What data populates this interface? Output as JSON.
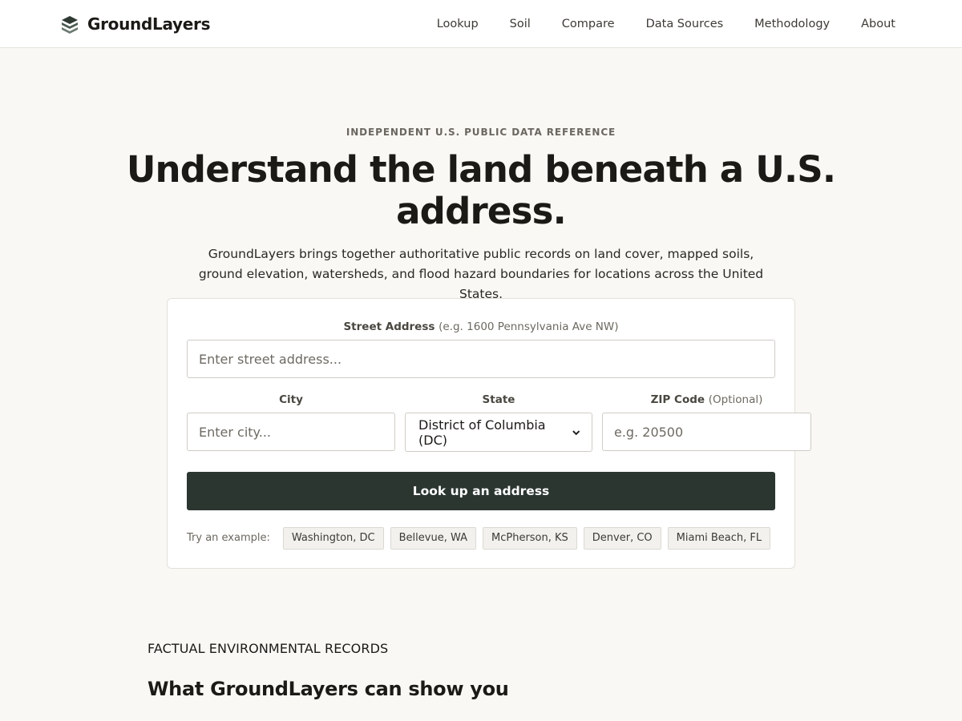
{
  "header": {
    "logo_text": "GroundLayers",
    "logo_icon": "layers-stack-icon",
    "nav": [
      {
        "label": "Lookup"
      },
      {
        "label": "Soil"
      },
      {
        "label": "Compare"
      },
      {
        "label": "Data Sources"
      },
      {
        "label": "Methodology"
      },
      {
        "label": "About"
      }
    ]
  },
  "hero": {
    "eyebrow": "INDEPENDENT U.S. PUBLIC DATA REFERENCE",
    "title": "Understand the land beneath a U.S. address.",
    "subtitle": "GroundLayers brings together authoritative public records on land cover, mapped soils, ground elevation, watersheds, and flood hazard boundaries for locations across the United States."
  },
  "form": {
    "street": {
      "label": "Street Address",
      "hint": "(e.g. 1600 Pennsylvania Ave NW)",
      "placeholder": "Enter street address...",
      "value": ""
    },
    "city": {
      "label": "City",
      "placeholder": "Enter city...",
      "value": ""
    },
    "state": {
      "label": "State",
      "selected": "District of Columbia (DC)"
    },
    "zip": {
      "label": "ZIP Code",
      "hint": "(Optional)",
      "placeholder": "e.g. 20500",
      "value": ""
    },
    "submit_label": "Look up an address",
    "examples_label": "Try an example:",
    "examples": [
      {
        "label": "Washington, DC"
      },
      {
        "label": "Bellevue, WA"
      },
      {
        "label": "McPherson, KS"
      },
      {
        "label": "Denver, CO"
      },
      {
        "label": "Miami Beach, FL"
      }
    ]
  },
  "section": {
    "eyebrow": "FACTUAL ENVIRONMENTAL RECORDS",
    "title": "What GroundLayers can show you"
  },
  "colors": {
    "background": "#f9f8f5",
    "header_bg": "#ffffff",
    "button_bg": "#2b3630",
    "text": "#1c1a17"
  }
}
